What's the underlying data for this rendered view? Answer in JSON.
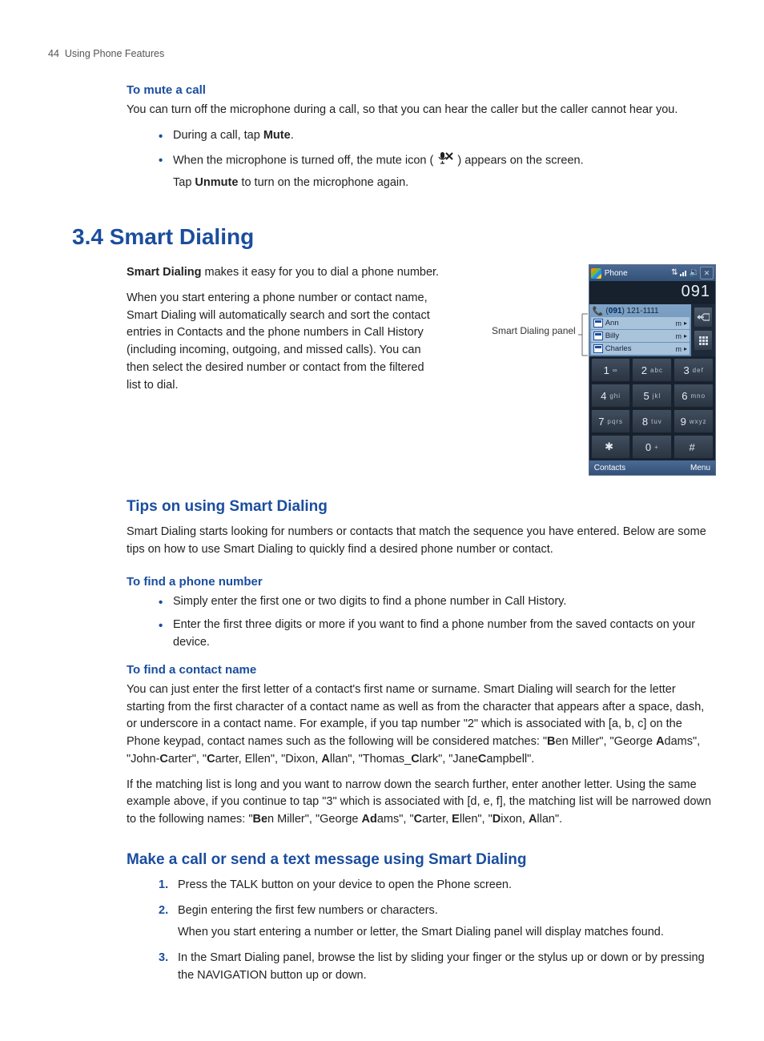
{
  "page_header": {
    "num": "44",
    "title": "Using Phone Features"
  },
  "mute": {
    "heading": "To mute a call",
    "intro": "You can turn off the microphone during a call, so that you can hear the caller but the caller cannot hear you.",
    "b1_pre": "During a call, tap ",
    "b1_bold": "Mute",
    "b1_post": ".",
    "b2_pre": "When the microphone is turned off, the mute icon ( ",
    "b2_post": " ) appears on the screen.",
    "b2_sub_pre": "Tap ",
    "b2_sub_bold": "Unmute",
    "b2_sub_post": " to turn on the microphone again."
  },
  "smart": {
    "heading": "3.4  Smart Dialing",
    "p1_bold": "Smart Dialing",
    "p1_rest": " makes it easy for you to dial a phone number.",
    "p2": "When you start entering a phone number or contact name, Smart Dialing will automatically search and sort the contact entries in Contacts and the phone numbers in Call History (including incoming, outgoing, and missed calls). You can then select the desired number or contact from the filtered list to dial.",
    "panel_label": "Smart Dialing panel"
  },
  "tips": {
    "heading": "Tips on using Smart Dialing",
    "intro": "Smart Dialing starts looking for numbers or contacts that match the sequence you have entered. Below are some tips on how to use Smart Dialing to quickly find a desired phone number or contact.",
    "find_num_heading": "To find a phone number",
    "fn_b1": "Simply enter the first one or two digits to find a phone number in Call History.",
    "fn_b2": "Enter the first three digits or more if you want to find a phone number from the saved contacts on your device.",
    "find_name_heading": "To find a contact name",
    "fcn_p1_a": "You can just enter the first letter of a contact's first name or surname. Smart Dialing will search for the letter starting from the first character of a contact name as well as from the character that appears after a space, dash, or underscore in a contact name. For example, if you tap number \"2\" which is associated with [a, b, c] on the Phone keypad, contact names such as the following will be considered matches: \"",
    "bold_B1": "B",
    "fcn_seg1": "en Miller\", \"George ",
    "bold_A1": "A",
    "fcn_seg2": "dams\", \"John-",
    "bold_C1": "C",
    "fcn_seg3": "arter\", \"",
    "bold_C2": "C",
    "fcn_seg4": "arter, Ellen\", \"Dixon, ",
    "bold_A2": "A",
    "fcn_seg5": "llan\", \"Thomas_",
    "bold_C3": "C",
    "fcn_seg6": "lark\", \"Jane",
    "bold_C4": "C",
    "fcn_seg7": "ampbell\".",
    "fcn_p2_a": "If the matching list is long and you want to narrow down the search further, enter another letter. Using the same example above, if you continue to tap \"3\" which is associated with [d, e, f], the matching list will be narrowed down to the following names: \"",
    "bold_Be": "Be",
    "fcn_seg8": "n Miller\", \"George ",
    "bold_Ad": "Ad",
    "fcn_seg9": "ams\", \"",
    "bold_C5": "C",
    "fcn_seg10": "arter, ",
    "bold_E1": "E",
    "fcn_seg11": "llen\", \"",
    "bold_D1": "D",
    "fcn_seg12": "ixon, ",
    "bold_A3": "A",
    "fcn_seg13": "llan\"."
  },
  "make": {
    "heading": "Make a call or send a text message using Smart Dialing",
    "s1": "Press the TALK button on your device to open the Phone screen.",
    "s2": "Begin entering the first few numbers or characters.",
    "s2b": "When you start entering a number or letter, the Smart Dialing panel will display matches found.",
    "s3": "In the Smart Dialing panel, browse the list by sliding your finger or the stylus up or down or by pressing the NAVIGATION button up or down."
  },
  "phone": {
    "title": "Phone",
    "display": "091",
    "hdr_num_pre": "(",
    "hdr_num_hl": "091",
    "hdr_num_post": ") 121-1111",
    "rows": [
      {
        "name": "Ann",
        "m": "m"
      },
      {
        "name": "Billy",
        "m": "m"
      },
      {
        "name": "Charles",
        "m": "m"
      }
    ],
    "keys": [
      {
        "n": "1",
        "l": "∞"
      },
      {
        "n": "2",
        "l": "abc"
      },
      {
        "n": "3",
        "l": "def"
      },
      {
        "n": "4",
        "l": "ghi"
      },
      {
        "n": "5",
        "l": "jkl"
      },
      {
        "n": "6",
        "l": "mno"
      },
      {
        "n": "7",
        "l": "pqrs"
      },
      {
        "n": "8",
        "l": "tuv"
      },
      {
        "n": "9",
        "l": "wxyz"
      },
      {
        "n": "✱",
        "l": ""
      },
      {
        "n": "0",
        "l": "+"
      },
      {
        "n": "#",
        "l": ""
      }
    ],
    "soft_left": "Contacts",
    "soft_right": "Menu"
  }
}
